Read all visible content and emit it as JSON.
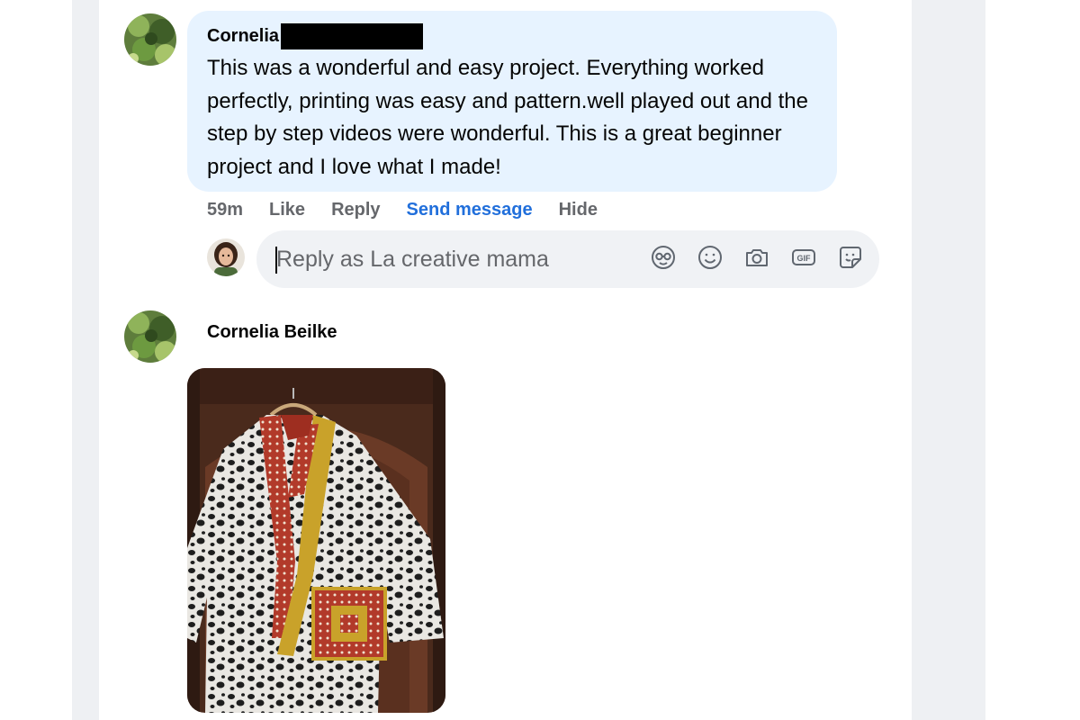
{
  "comment1": {
    "author": "Cornelia",
    "text": "This was a wonderful and easy project. Everything worked perfectly, printing was easy and pattern.well played out and the step by step videos were wonderful. This is a great beginner project and I love what I made!",
    "actions": {
      "time": "59m",
      "like": "Like",
      "reply": "Reply",
      "send_message": "Send message",
      "hide": "Hide"
    }
  },
  "reply_box": {
    "placeholder": "Reply as La creative mama",
    "icons": [
      "avatar-sticker-icon",
      "emoji-icon",
      "camera-icon",
      "gif-icon",
      "sticker-icon"
    ]
  },
  "comment2": {
    "author": "Cornelia Beilke"
  },
  "colors": {
    "bubble": "#e7f3ff",
    "link": "#216fdb",
    "muted": "#65676b",
    "input_bg": "#f0f2f5"
  }
}
